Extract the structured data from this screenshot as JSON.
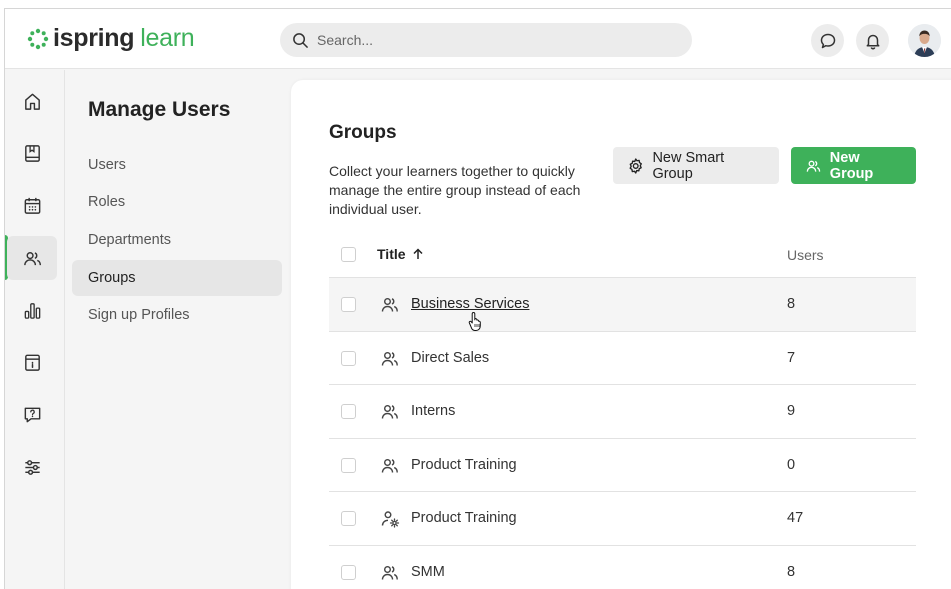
{
  "brand": {
    "name_part1": "ispring",
    "name_part2": "learn",
    "color": "#3eb15a"
  },
  "search": {
    "placeholder": "Search..."
  },
  "header_icons": [
    "chat-icon",
    "bell-icon",
    "user-avatar"
  ],
  "rail": {
    "items": [
      {
        "icon": "home-icon",
        "active": false
      },
      {
        "icon": "book-icon",
        "active": false
      },
      {
        "icon": "calendar-icon",
        "active": false
      },
      {
        "icon": "users-icon",
        "active": true
      },
      {
        "icon": "bar-chart-icon",
        "active": false
      },
      {
        "icon": "info-card-icon",
        "active": false
      },
      {
        "icon": "help-chat-icon",
        "active": false
      },
      {
        "icon": "sliders-icon",
        "active": false
      }
    ]
  },
  "subnav": {
    "title": "Manage Users",
    "items": [
      {
        "label": "Users",
        "active": false
      },
      {
        "label": "Roles",
        "active": false
      },
      {
        "label": "Departments",
        "active": false
      },
      {
        "label": "Groups",
        "active": true
      },
      {
        "label": "Sign up Profiles",
        "active": false
      }
    ]
  },
  "main": {
    "title": "Groups",
    "description": "Collect your learners together to quickly manage the entire group instead of each individual user.",
    "smart_group_label": "New Smart Group",
    "new_group_label": "New Group"
  },
  "table": {
    "col_title": "Title",
    "col_users": "Users",
    "sort": "ascending",
    "rows": [
      {
        "title": "Business Services",
        "users": "8",
        "icon": "group-icon",
        "hover": true
      },
      {
        "title": "Direct Sales",
        "users": "7",
        "icon": "group-icon",
        "hover": false
      },
      {
        "title": "Interns",
        "users": "9",
        "icon": "group-icon",
        "hover": false
      },
      {
        "title": "Product Training",
        "users": "0",
        "icon": "group-icon",
        "hover": false
      },
      {
        "title": "Product Training",
        "users": "47",
        "icon": "smart-group-icon",
        "hover": false
      },
      {
        "title": "SMM",
        "users": "8",
        "icon": "group-icon",
        "hover": false
      }
    ]
  }
}
